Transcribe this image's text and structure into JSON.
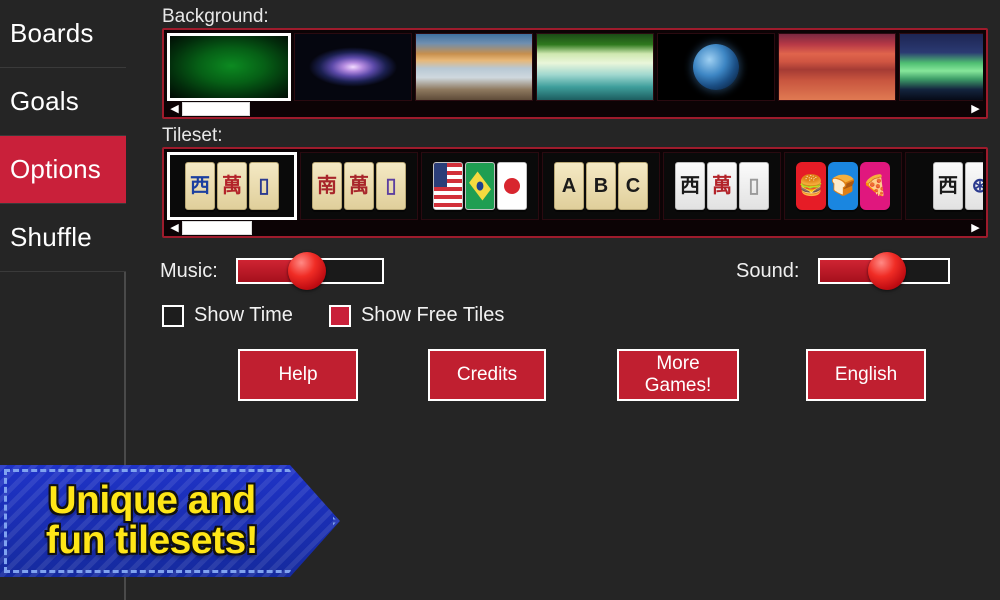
{
  "app": {
    "bg_color": "#252525",
    "accent_color": "#c9203a",
    "panel_border_color": "#9e1b2c"
  },
  "sidebar": {
    "items": [
      {
        "label": "Boards",
        "active": false
      },
      {
        "label": "Goals",
        "active": false
      },
      {
        "label": "Options",
        "active": true
      },
      {
        "label": "Shuffle",
        "active": false
      }
    ]
  },
  "background_section": {
    "label": "Background:",
    "left_arrow_icon": "triangle-left-icon",
    "right_arrow_icon": "triangle-right-icon",
    "selected_index": 0,
    "thumbs": [
      {
        "name": "green-felt",
        "art": "bg-green",
        "selected": true
      },
      {
        "name": "galaxy",
        "art": "bg-galaxy",
        "selected": false
      },
      {
        "name": "beach-arch",
        "art": "bg-beach",
        "selected": false
      },
      {
        "name": "forest-lake",
        "art": "bg-forest",
        "selected": false
      },
      {
        "name": "earth",
        "art": "bg-earth",
        "selected": false
      },
      {
        "name": "red-desert",
        "art": "bg-desert",
        "selected": false
      },
      {
        "name": "aurora",
        "art": "bg-aurora",
        "selected": false
      }
    ]
  },
  "tileset_section": {
    "label": "Tileset:",
    "left_arrow_icon": "triangle-left-icon",
    "right_arrow_icon": "triangle-right-icon",
    "selected_index": 0,
    "thumbs": [
      {
        "name": "classic-ivory",
        "style": "ivory",
        "selected": true,
        "tiles": [
          {
            "text": "西",
            "color": "#1b3fa0"
          },
          {
            "text": "萬",
            "color": "#b3232a"
          },
          {
            "text": "▯",
            "color": "#2b3a8f"
          }
        ]
      },
      {
        "name": "wood-tiles",
        "style": "ivory",
        "selected": false,
        "tiles": [
          {
            "text": "南",
            "color": "#a8262b"
          },
          {
            "text": "萬",
            "color": "#a8262b"
          },
          {
            "text": "▯",
            "color": "#5c3fa0"
          }
        ]
      },
      {
        "name": "flags",
        "style": "flag",
        "selected": false,
        "tiles": [
          {
            "flag": "us"
          },
          {
            "flag": "br"
          },
          {
            "flag": "jp"
          }
        ]
      },
      {
        "name": "letters-abc",
        "style": "ivory",
        "selected": false,
        "tiles": [
          {
            "text": "A",
            "color": "#1a1a1a"
          },
          {
            "text": "B",
            "color": "#1a1a1a"
          },
          {
            "text": "C",
            "color": "#1a1a1a"
          }
        ]
      },
      {
        "name": "white-modern",
        "style": "white",
        "selected": false,
        "tiles": [
          {
            "text": "西",
            "color": "#1a1a1a"
          },
          {
            "text": "萬",
            "color": "#b3232a"
          },
          {
            "text": "▯",
            "color": "#9a9a9a"
          }
        ]
      },
      {
        "name": "food-icons",
        "style": "food",
        "selected": false,
        "tiles": [
          {
            "text": "🍔",
            "bg": "#e61c26"
          },
          {
            "text": "🍞",
            "bg": "#1a86e0"
          },
          {
            "text": "🍕",
            "bg": "#e0177e"
          }
        ]
      },
      {
        "name": "ornate-white",
        "style": "white",
        "selected": false,
        "tiles": [
          {
            "text": "西",
            "color": "#1a1a1a"
          },
          {
            "text": "⊛",
            "color": "#2b3a8f"
          }
        ]
      }
    ]
  },
  "sliders": {
    "music": {
      "label": "Music:",
      "value": 48,
      "fill_color": "#c02030",
      "knob_color": "#e8201c"
    },
    "sound": {
      "label": "Sound:",
      "value": 52,
      "fill_color": "#c02030",
      "knob_color": "#e8201c"
    }
  },
  "checkboxes": [
    {
      "label": "Show Time",
      "checked": false
    },
    {
      "label": "Show Free Tiles",
      "checked": true
    }
  ],
  "buttons": [
    {
      "label": "Help"
    },
    {
      "label": "Credits"
    },
    {
      "label": "More\nGames!"
    },
    {
      "label": "English"
    }
  ],
  "banner": {
    "line1": "Unique and",
    "line2": "fun tilesets!",
    "text_color": "#ffe617",
    "bg_color": "#1f33c8"
  }
}
